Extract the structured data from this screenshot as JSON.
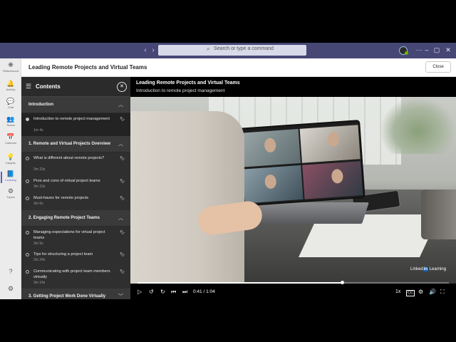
{
  "titlebar": {
    "search_placeholder": "Search or type a command",
    "back_icon": "‹",
    "forward_icon": "›",
    "more_icon": "···",
    "minimize_icon": "–",
    "maximize_icon": "▢",
    "close_icon": "✕",
    "color": "#464775"
  },
  "rail": {
    "items": [
      {
        "icon": "❋",
        "label": "Reflectcloud"
      },
      {
        "icon": "🔔",
        "label": "Activity"
      },
      {
        "icon": "💬",
        "label": "Chat"
      },
      {
        "icon": "👥",
        "label": "Teams"
      },
      {
        "icon": "📅",
        "label": "Calendar"
      },
      {
        "icon": "💡",
        "label": "Insights"
      },
      {
        "icon": "📘",
        "label": "Learning"
      },
      {
        "icon": "⚙",
        "label": "Topics"
      }
    ],
    "help_icon": "?",
    "settings_icon": "⚙",
    "active": "Learning"
  },
  "header": {
    "title": "Leading Remote Projects and Virtual Teams",
    "close_label": "Close"
  },
  "contents": {
    "title": "Contents",
    "close_icon": "✕",
    "sections": [
      {
        "title": "Introduction",
        "chevron": "︿",
        "lessons": [
          {
            "title": "Introduction to remote project management",
            "duration": "1m 4s",
            "current": true
          }
        ]
      },
      {
        "title": "1. Remote and Virtual Projects Overview",
        "chevron": "︿",
        "lessons": [
          {
            "title": "What is different about remote projects?",
            "duration": "2m 23s"
          },
          {
            "title": "Pros and cons of virtual project teams",
            "duration": "3m 10s"
          },
          {
            "title": "Must-haves for remote projects",
            "duration": "3m 6s"
          }
        ]
      },
      {
        "title": "2. Engaging Remote Project Teams",
        "chevron": "︿",
        "lessons": [
          {
            "title": "Managing expectations for virtual project teams",
            "duration": "3m 5s"
          },
          {
            "title": "Tips for structuring a project team",
            "duration": "2m 24s"
          },
          {
            "title": "Communicating with project team members virtually",
            "duration": "3m 14s"
          }
        ]
      },
      {
        "title": "3. Getting Project Work Done Virtually",
        "chevron": "﹀",
        "lessons": []
      }
    ]
  },
  "video": {
    "title": "Leading Remote Projects and Virtual Teams",
    "subtitle": "Introduction to remote project management",
    "watermark_prefix": "Linked",
    "watermark_in": "in",
    "watermark_suffix": " Learning",
    "progress": 0.656
  },
  "player": {
    "play_icon": "▷",
    "back10_icon": "↺",
    "fwd10_icon": "↻",
    "prev_icon": "⏮",
    "next_icon": "⏭",
    "time": "0:41 / 1:04",
    "speed": "1x",
    "captions_icon": "CC",
    "settings_icon": "⚙",
    "volume_icon": "🔊",
    "fullscreen_icon": "⛶"
  }
}
